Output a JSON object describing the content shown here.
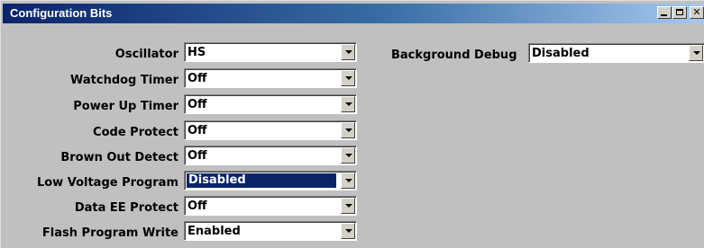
{
  "window": {
    "title": "Configuration Bits",
    "controls": {
      "minimize_icon": "minimize-icon",
      "maximize_icon": "maximize-icon",
      "close_icon": "close-icon"
    }
  },
  "left_fields": [
    {
      "label": "Oscillator",
      "value": "HS",
      "selected": false
    },
    {
      "label": "Watchdog Timer",
      "value": "Off",
      "selected": false
    },
    {
      "label": "Power Up Timer",
      "value": "Off",
      "selected": false
    },
    {
      "label": "Code Protect",
      "value": "Off",
      "selected": false
    },
    {
      "label": "Brown Out Detect",
      "value": "Off",
      "selected": false
    },
    {
      "label": "Low Voltage Program",
      "value": "Disabled",
      "selected": true
    },
    {
      "label": "Data EE Protect",
      "value": "Off",
      "selected": false
    },
    {
      "label": "Flash Program Write",
      "value": "Enabled",
      "selected": false
    }
  ],
  "right_fields": [
    {
      "label": "Background Debug",
      "value": "Disabled",
      "selected": false
    }
  ],
  "colors": {
    "titlebar_start": "#0a246a",
    "titlebar_end": "#a6caf0",
    "panel": "#c0c0c0",
    "selection": "#0a246a"
  }
}
